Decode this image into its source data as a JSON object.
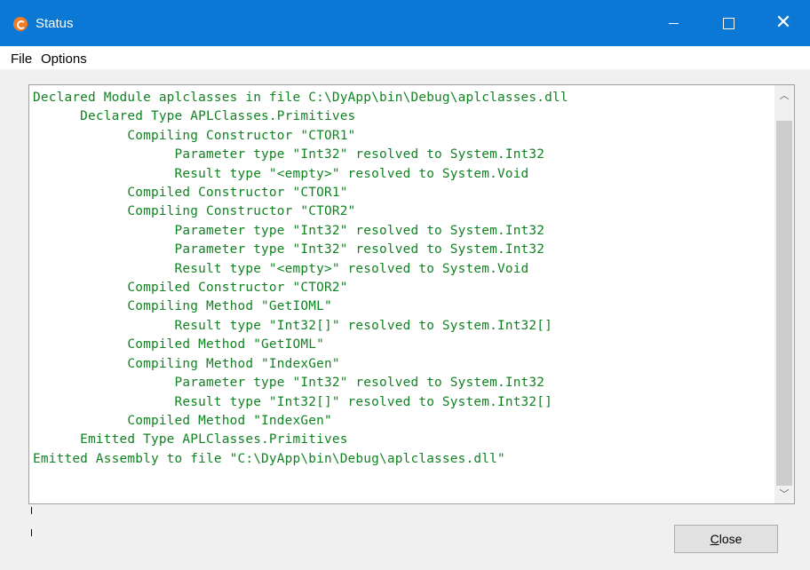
{
  "window": {
    "title": "Status",
    "icon": "dyalog-icon",
    "accent_color": "#0a78d4",
    "controls": [
      "minimize-icon",
      "maximize-icon",
      "close-icon"
    ]
  },
  "menu": {
    "items": [
      {
        "label": "File"
      },
      {
        "label": "Options"
      }
    ]
  },
  "log": {
    "text_color": "#118222",
    "lines": [
      "Declared Module aplclasses in file C:\\DyApp\\bin\\Debug\\aplclasses.dll",
      "      Declared Type APLClasses.Primitives",
      "            Compiling Constructor \"CTOR1\"",
      "                  Parameter type \"Int32\" resolved to System.Int32",
      "                  Result type \"<empty>\" resolved to System.Void",
      "            Compiled Constructor \"CTOR1\"",
      "            Compiling Constructor \"CTOR2\"",
      "                  Parameter type \"Int32\" resolved to System.Int32",
      "                  Parameter type \"Int32\" resolved to System.Int32",
      "                  Result type \"<empty>\" resolved to System.Void",
      "            Compiled Constructor \"CTOR2\"",
      "            Compiling Method \"GetIOML\"",
      "                  Result type \"Int32[]\" resolved to System.Int32[]",
      "            Compiled Method \"GetIOML\"",
      "            Compiling Method \"IndexGen\"",
      "                  Parameter type \"Int32\" resolved to System.Int32",
      "                  Result type \"Int32[]\" resolved to System.Int32[]",
      "            Compiled Method \"IndexGen\"",
      "      Emitted Type APLClasses.Primitives",
      "Emitted Assembly to file \"C:\\DyApp\\bin\\Debug\\aplclasses.dll\""
    ]
  },
  "buttons": {
    "close_label_underlined": "C",
    "close_label_rest": "lose"
  }
}
